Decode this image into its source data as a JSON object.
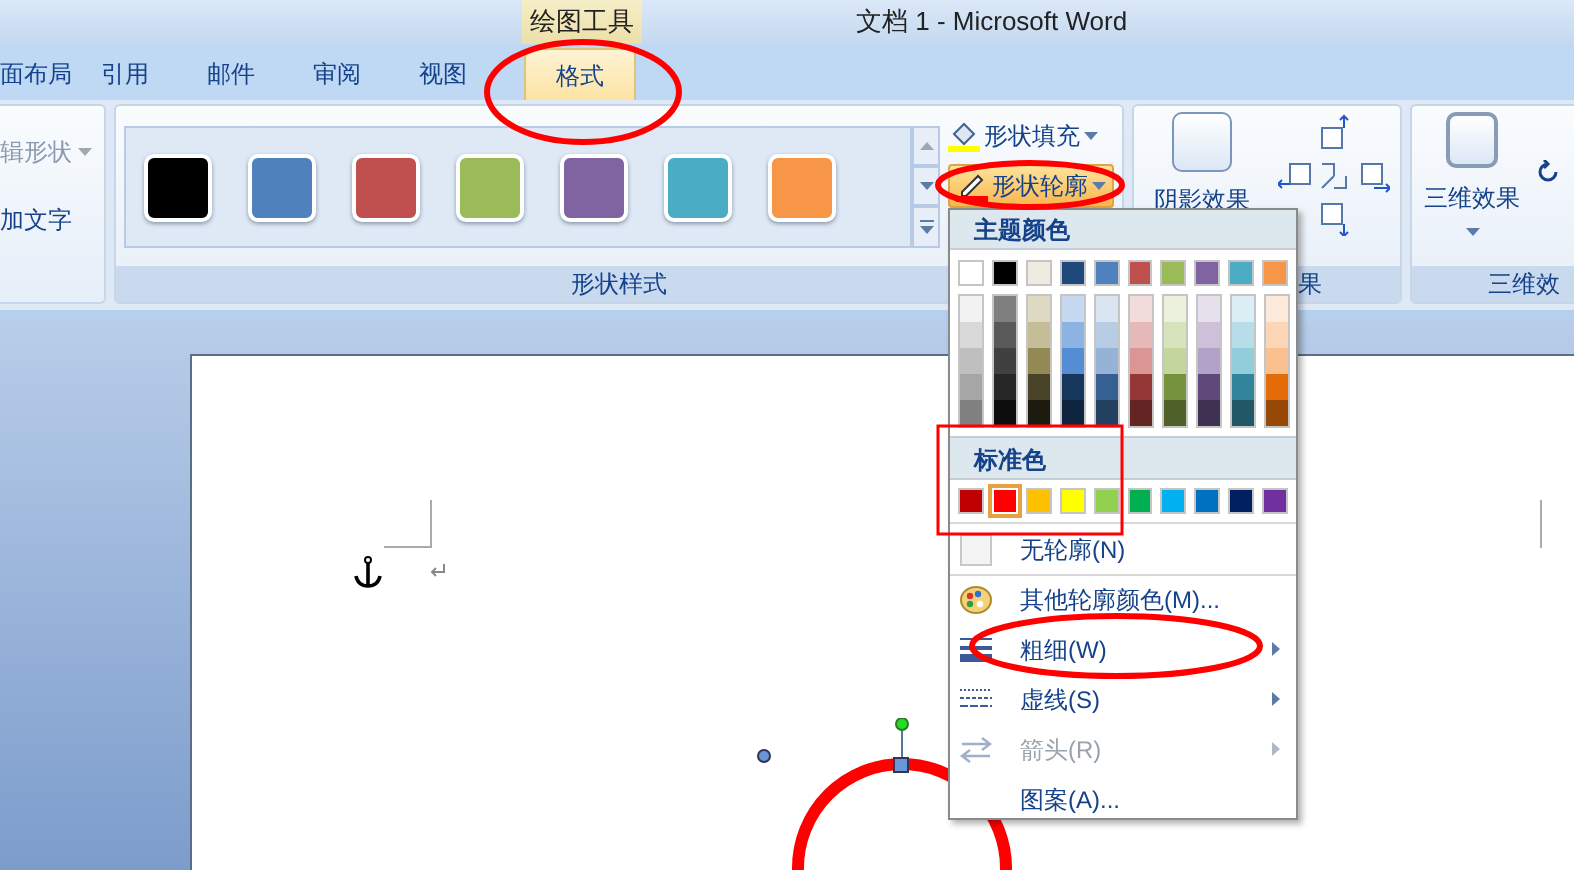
{
  "title_bar": {
    "contextual_tab": "绘图工具",
    "title": "文档 1 - Microsoft Word"
  },
  "tabs": [
    {
      "label": "面布局",
      "selected": false
    },
    {
      "label": "引用",
      "selected": false
    },
    {
      "label": "邮件",
      "selected": false
    },
    {
      "label": "审阅",
      "selected": false
    },
    {
      "label": "视图",
      "selected": false
    },
    {
      "label": "格式",
      "selected": true
    }
  ],
  "ribbon": {
    "left_group": {
      "items": [
        "辑形状",
        "加文字"
      ]
    },
    "shape_styles": {
      "label": "形状样式",
      "swatches": [
        {
          "color": "#000000"
        },
        {
          "color": "#4f81bd"
        },
        {
          "color": "#c0504d"
        },
        {
          "color": "#9bbb59"
        },
        {
          "color": "#8064a2"
        },
        {
          "color": "#4bacc6"
        },
        {
          "color": "#f79646"
        }
      ],
      "fill_button": "形状填充",
      "outline_button": "形状轮廓"
    },
    "shadow": {
      "button": "阴影效果",
      "group_label": "果"
    },
    "three_d": {
      "button": "三维效果",
      "group_label": "三维效"
    }
  },
  "outline_menu": {
    "theme_heading": "主题颜色",
    "theme_colors": [
      {
        "color": "#ffffff"
      },
      {
        "color": "#000000"
      },
      {
        "color": "#eeece1"
      },
      {
        "color": "#1f497d"
      },
      {
        "color": "#4f81bd"
      },
      {
        "color": "#c0504d"
      },
      {
        "color": "#9bbb59"
      },
      {
        "color": "#8064a2"
      },
      {
        "color": "#4bacc6"
      },
      {
        "color": "#f79646"
      }
    ],
    "shades": [
      [
        {
          "color": "#f2f2f2"
        },
        {
          "color": "#d9d9d9"
        },
        {
          "color": "#bfbfbf"
        },
        {
          "color": "#a6a6a6"
        },
        {
          "color": "#808080"
        }
      ],
      [
        {
          "color": "#7f7f7f"
        },
        {
          "color": "#595959"
        },
        {
          "color": "#404040"
        },
        {
          "color": "#262626"
        },
        {
          "color": "#0d0d0d"
        }
      ],
      [
        {
          "color": "#ddd9c3"
        },
        {
          "color": "#c4bd97"
        },
        {
          "color": "#938953"
        },
        {
          "color": "#494429"
        },
        {
          "color": "#1d1b10"
        }
      ],
      [
        {
          "color": "#c6d9f0"
        },
        {
          "color": "#8db3e2"
        },
        {
          "color": "#548dd4"
        },
        {
          "color": "#17365d"
        },
        {
          "color": "#0f243e"
        }
      ],
      [
        {
          "color": "#dbe5f1"
        },
        {
          "color": "#b8cce4"
        },
        {
          "color": "#95b3d7"
        },
        {
          "color": "#366092"
        },
        {
          "color": "#244061"
        }
      ],
      [
        {
          "color": "#f2dcdb"
        },
        {
          "color": "#e5b9b7"
        },
        {
          "color": "#d99694"
        },
        {
          "color": "#953734"
        },
        {
          "color": "#632423"
        }
      ],
      [
        {
          "color": "#ebf1dd"
        },
        {
          "color": "#d7e3bc"
        },
        {
          "color": "#c3d69b"
        },
        {
          "color": "#76923c"
        },
        {
          "color": "#4f6128"
        }
      ],
      [
        {
          "color": "#e5e0ec"
        },
        {
          "color": "#ccc1d9"
        },
        {
          "color": "#b2a2c7"
        },
        {
          "color": "#5f497a"
        },
        {
          "color": "#3f3151"
        }
      ],
      [
        {
          "color": "#dbeef3"
        },
        {
          "color": "#b7dde8"
        },
        {
          "color": "#92cddc"
        },
        {
          "color": "#31859b"
        },
        {
          "color": "#205867"
        }
      ],
      [
        {
          "color": "#fdeada"
        },
        {
          "color": "#fbd5b5"
        },
        {
          "color": "#fac08f"
        },
        {
          "color": "#e36c09"
        },
        {
          "color": "#974806"
        }
      ]
    ],
    "standard_heading": "标准色",
    "standard_colors": [
      {
        "color": "#c00000",
        "selected": false
      },
      {
        "color": "#ff0000",
        "selected": true
      },
      {
        "color": "#ffc000",
        "selected": false
      },
      {
        "color": "#ffff00",
        "selected": false
      },
      {
        "color": "#92d050",
        "selected": false
      },
      {
        "color": "#00b050",
        "selected": false
      },
      {
        "color": "#00b0f0",
        "selected": false
      },
      {
        "color": "#0070c0",
        "selected": false
      },
      {
        "color": "#002060",
        "selected": false
      },
      {
        "color": "#7030a0",
        "selected": false
      }
    ],
    "items": [
      {
        "kind": "none",
        "label": "无轮廓(N)",
        "disabled": false,
        "submenu": false
      },
      {
        "kind": "palette",
        "label": "其他轮廓颜色(M)...",
        "disabled": false,
        "submenu": false
      },
      {
        "kind": "weight",
        "label": "粗细(W)",
        "disabled": false,
        "submenu": true
      },
      {
        "kind": "dash",
        "label": "虚线(S)",
        "disabled": false,
        "submenu": true
      },
      {
        "kind": "arrow",
        "label": "箭头(R)",
        "disabled": true,
        "submenu": true
      },
      {
        "kind": "plain",
        "label": "图案(A)...",
        "disabled": false,
        "submenu": false
      }
    ]
  }
}
